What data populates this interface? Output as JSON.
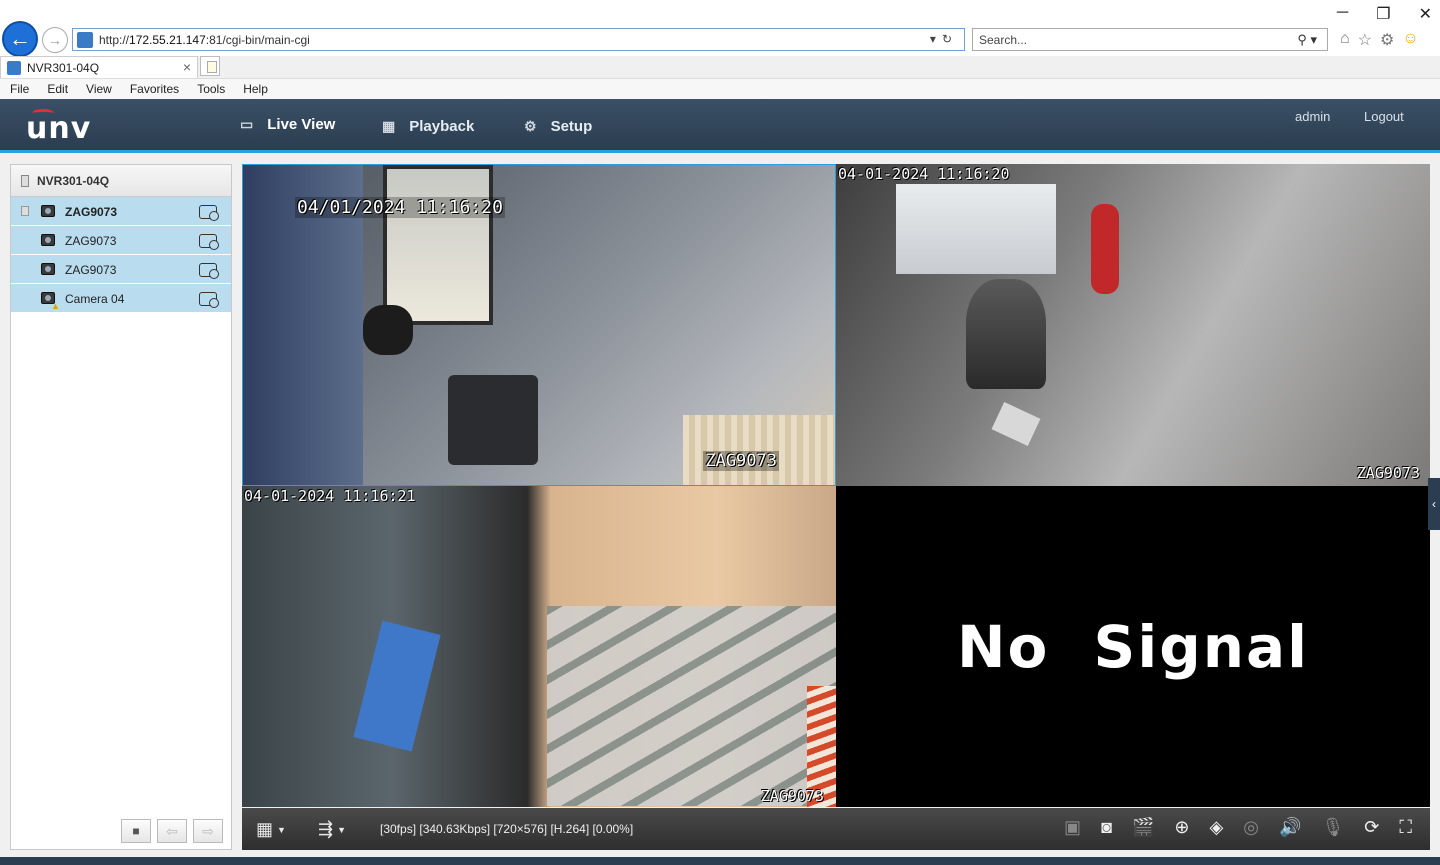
{
  "browser": {
    "url_prefix": "http://",
    "url_host": "172.55.21.147",
    "url_rest": ":81/cgi-bin/main-cgi",
    "search_placeholder": "Search...",
    "tab_title": "NVR301-04Q",
    "tab_close": "×",
    "menu": [
      "File",
      "Edit",
      "View",
      "Favorites",
      "Tools",
      "Help"
    ],
    "window_controls": [
      "─",
      "❐",
      "✕"
    ]
  },
  "app": {
    "logo": "unv",
    "nav": [
      {
        "label": "Live View",
        "icon": "monitor-icon",
        "active": true
      },
      {
        "label": "Playback",
        "icon": "playback-icon",
        "active": false
      },
      {
        "label": "Setup",
        "icon": "gear-icon",
        "active": false
      }
    ],
    "user": "admin",
    "logout": "Logout"
  },
  "sidebar": {
    "root": "NVR301-04Q",
    "cameras": [
      {
        "label": "ZAG9073",
        "selected": true,
        "warning": false
      },
      {
        "label": "ZAG9073",
        "selected": false,
        "warning": false
      },
      {
        "label": "ZAG9073",
        "selected": false,
        "warning": false
      },
      {
        "label": "Camera 04",
        "selected": false,
        "warning": true
      }
    ]
  },
  "video": {
    "panes": [
      {
        "timestamp": "04/01/2024 11:16:20",
        "name": "ZAG9073"
      },
      {
        "timestamp": "04-01-2024 11:16:20",
        "name": "ZAG9073"
      },
      {
        "timestamp": "04-01-2024 11:16:21",
        "name": "ZAG9073"
      },
      {
        "timestamp": "",
        "name": "",
        "no_signal": "No  Signal"
      }
    ]
  },
  "toolbar": {
    "status": "[30fps] [340.63Kbps] [720×576] [H.264] [0.00%]"
  },
  "colors": {
    "accent": "#2a9fe0",
    "header": "#2b3d50",
    "selected_row": "#b9dcef"
  }
}
